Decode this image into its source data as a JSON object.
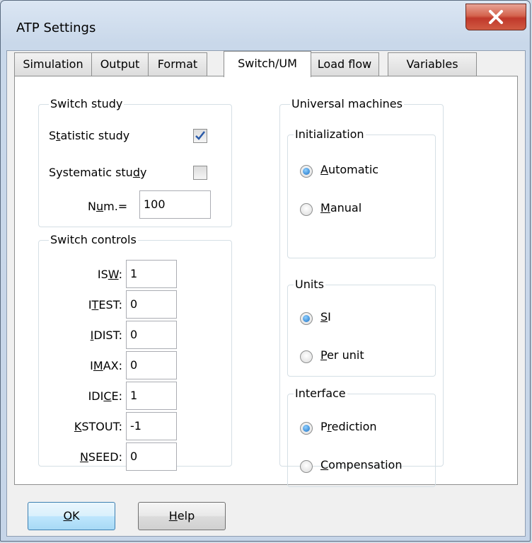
{
  "window": {
    "title": "ATP Settings"
  },
  "tabs": [
    {
      "label": "Simulation"
    },
    {
      "label": "Output"
    },
    {
      "label": "Format"
    },
    {
      "label": "Switch/UM",
      "active": true
    },
    {
      "label": "Load flow"
    },
    {
      "label": "Variables"
    }
  ],
  "switch_study": {
    "legend": "Switch study",
    "statistic_label": "Statistic study",
    "statistic_checked": true,
    "systematic_label": "Systematic study",
    "systematic_checked": false,
    "num_label": "Num.=",
    "num_value": "100"
  },
  "switch_controls": {
    "legend": "Switch controls",
    "fields": [
      {
        "label": "ISW:",
        "value": "1"
      },
      {
        "label": "ITEST:",
        "value": "0"
      },
      {
        "label": "IDIST:",
        "value": "0"
      },
      {
        "label": "IMAX:",
        "value": "0"
      },
      {
        "label": "IDICE:",
        "value": "1"
      },
      {
        "label": "KSTOUT:",
        "value": "-1"
      },
      {
        "label": "NSEED:",
        "value": "0"
      }
    ]
  },
  "universal_machines": {
    "legend": "Universal machines",
    "initialization": {
      "legend": "Initialization",
      "options": [
        "Automatic",
        "Manual"
      ],
      "selected": "Automatic"
    },
    "units": {
      "legend": "Units",
      "options": [
        "SI",
        "Per unit"
      ],
      "selected": "SI"
    },
    "interface": {
      "legend": "Interface",
      "options": [
        "Prediction",
        "Compensation"
      ],
      "selected": "Prediction"
    }
  },
  "buttons": {
    "ok": "OK",
    "help": "Help"
  },
  "colors": {
    "accent": "#1a6fc4",
    "close": "#c0392b"
  }
}
